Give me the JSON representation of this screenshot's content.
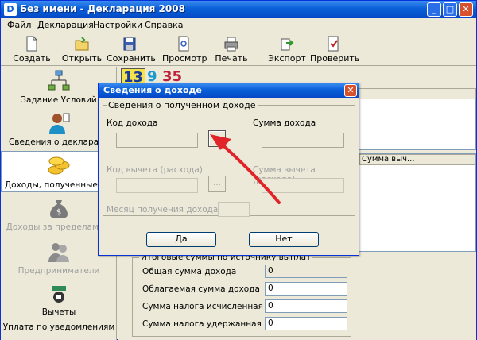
{
  "window": {
    "title": "Без имени - Декларация 2008",
    "app_icon": "D",
    "controls": [
      "minimize",
      "maximize",
      "close"
    ]
  },
  "menu": [
    "Файл",
    "Декларация",
    "Настройки",
    "Справка"
  ],
  "toolbar": {
    "buttons": [
      {
        "label": "Создать",
        "icon": "new-document-icon"
      },
      {
        "label": "Открыть",
        "icon": "open-folder-icon"
      },
      {
        "label": "Сохранить",
        "icon": "save-disk-icon"
      },
      {
        "label": "Просмотр",
        "icon": "preview-icon"
      },
      {
        "label": "Печать",
        "icon": "printer-icon"
      },
      {
        "label": "Экспорт",
        "icon": "export-icon"
      },
      {
        "label": "Проверить",
        "icon": "check-icon"
      }
    ]
  },
  "sidebar": {
    "items": [
      {
        "label": "Задание Условий",
        "icon": "conditions-tree-icon",
        "state": "normal"
      },
      {
        "label": "Сведения о декларант",
        "icon": "person-icon",
        "state": "normal"
      },
      {
        "label": "Доходы, полученные в Р",
        "icon": "coins-icon",
        "state": "active"
      },
      {
        "label": "Доходы за пределами Р",
        "icon": "money-bag-icon",
        "state": "disabled"
      },
      {
        "label": "Предприниматели",
        "icon": "entrepreneurs-icon",
        "state": "disabled"
      },
      {
        "label": "Вычеты",
        "icon": "deductions-icon",
        "state": "normal"
      },
      {
        "label": "Уплата по уведомлениям",
        "icon": "",
        "state": "normal"
      }
    ]
  },
  "content": {
    "rates": [
      "13",
      "9",
      "35"
    ],
    "grid_header_fragment": "Сумма выч...",
    "totals": {
      "legend": "Итоговые суммы по источнику выплат",
      "rows": [
        {
          "label": "Общая сумма дохода",
          "value": "0"
        },
        {
          "label": "Облагаемая сумма дохода",
          "value": "0"
        },
        {
          "label": "Сумма налога исчисленная",
          "value": "0"
        },
        {
          "label": "Сумма налога удержанная",
          "value": "0"
        }
      ]
    }
  },
  "dialog": {
    "title": "Сведения о доходе",
    "group_legend": "Сведения о полученном доходе",
    "income_code_label": "Код дохода",
    "income_amount_label": "Сумма дохода",
    "deduction_code_label": "Код вычета (расхода)",
    "deduction_amount_label": "Сумма вычета (расхода)",
    "month_label": "Месяц получения дохода",
    "ellipsis": "...",
    "ok_label": "Да",
    "cancel_label": "Нет"
  },
  "colors": {
    "titlebar": "#0a5fd8",
    "face": "#ece9d8",
    "annotation_arrow": "#e0242a"
  }
}
